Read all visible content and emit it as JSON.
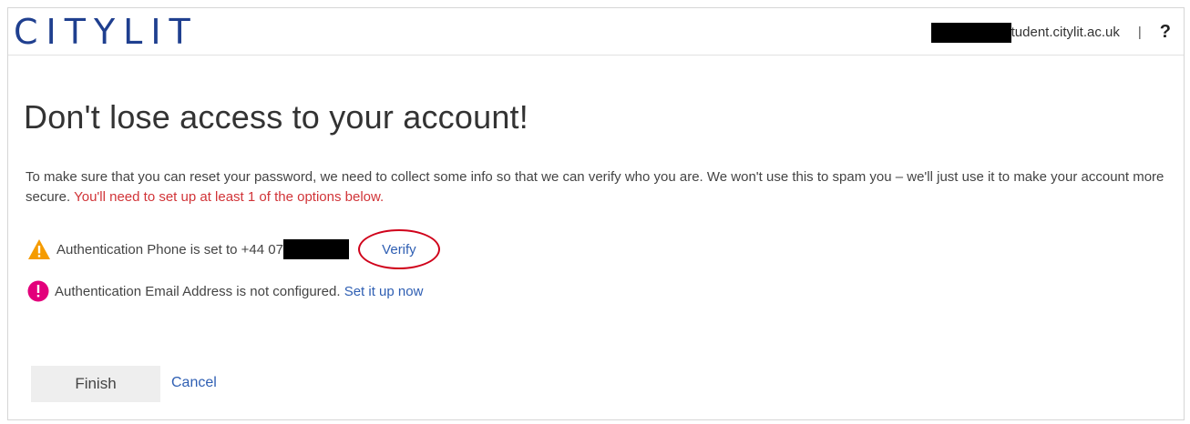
{
  "header": {
    "logo_text": "CITYLIT",
    "account_suffix": "tudent.citylit.ac.uk",
    "separator": "|",
    "help_symbol": "?"
  },
  "main": {
    "title": "Don't lose access to your account!",
    "description": "To make sure that you can reset your password, we need to collect some info so that we can verify who you are. We won't use this to spam you – we'll just use it to make your account more secure.",
    "warning_text": "You'll need to set up at least 1 of the options below.",
    "phone_row": {
      "text": "Authentication Phone is set to +44 07",
      "link": "Verify",
      "icon": "warning-triangle-icon"
    },
    "email_row": {
      "text": "Authentication Email Address is not configured.",
      "link": "Set it up now",
      "icon": "error-circle-icon"
    },
    "finish_label": "Finish",
    "cancel_label": "Cancel"
  },
  "colors": {
    "logo": "#1f3f8f",
    "link": "#2f5fb3",
    "warning_text": "#d13438",
    "warning_icon": "#f59b00",
    "error_icon": "#e3007b",
    "highlight_ellipse": "#d0021b"
  }
}
